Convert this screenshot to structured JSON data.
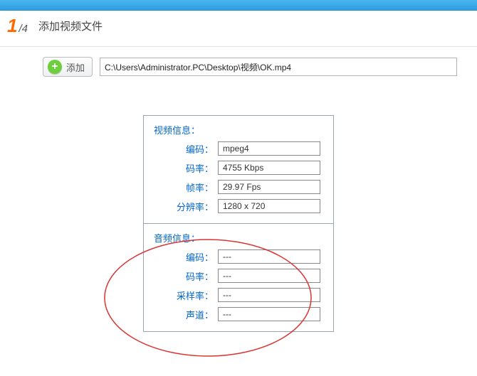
{
  "step": {
    "current": "1",
    "total": "/4",
    "title": "添加视频文件"
  },
  "add_button_label": "添加",
  "file_path": "C:\\Users\\Administrator.PC\\Desktop\\视频\\OK.mp4",
  "video": {
    "section_title": "视频信息：",
    "fields": [
      {
        "label": "编码：",
        "value": "mpeg4"
      },
      {
        "label": "码率：",
        "value": "4755 Kbps"
      },
      {
        "label": "帧率：",
        "value": "29.97 Fps"
      },
      {
        "label": "分辨率：",
        "value": "1280 x 720"
      }
    ]
  },
  "audio": {
    "section_title": "音频信息：",
    "fields": [
      {
        "label": "编码：",
        "value": "---"
      },
      {
        "label": "码率：",
        "value": "---"
      },
      {
        "label": "采样率：",
        "value": "---"
      },
      {
        "label": "声道：",
        "value": "---"
      }
    ]
  }
}
